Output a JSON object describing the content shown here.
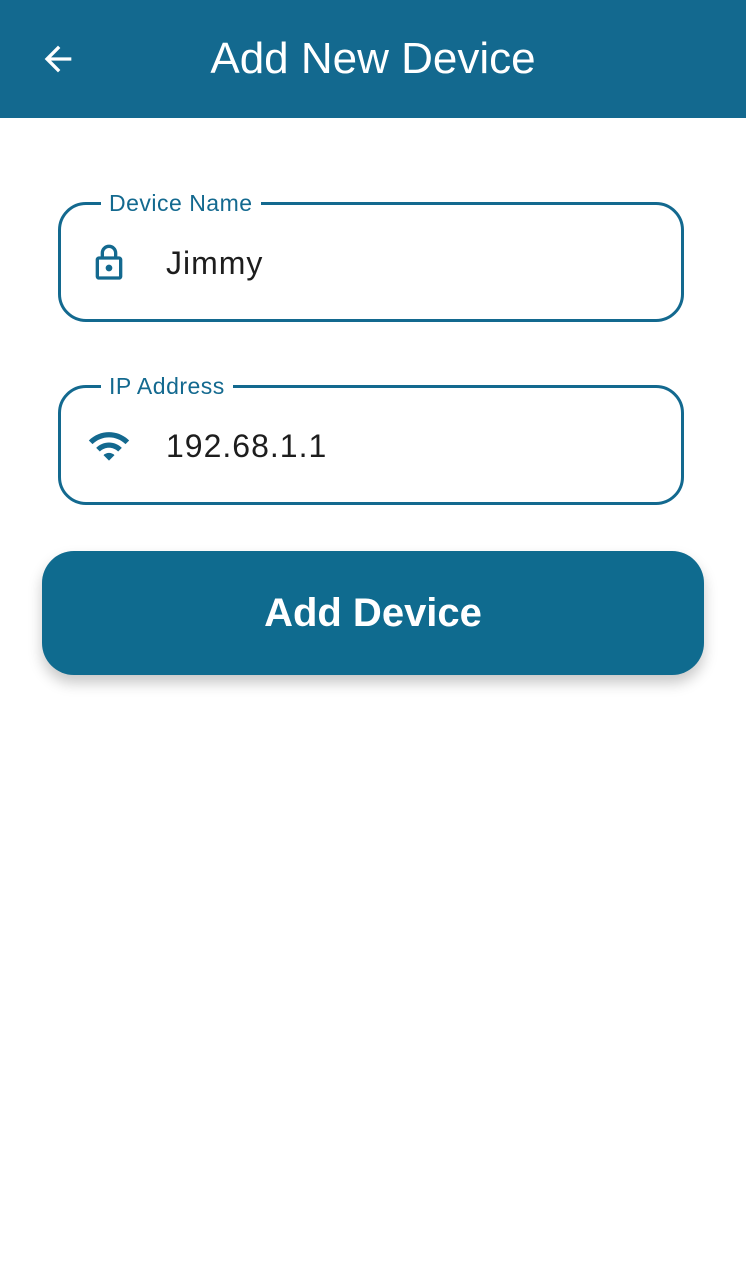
{
  "app_bar": {
    "title": "Add New Device",
    "back_icon": "arrow-left-icon",
    "background_color": "#13698f"
  },
  "form": {
    "device_name": {
      "label": "Device Name",
      "value": "Jimmy",
      "icon": "lock-icon"
    },
    "ip_address": {
      "label": "IP Address",
      "value": "192.68.1.1",
      "icon": "wifi-icon"
    }
  },
  "submit_button": {
    "label": "Add Device",
    "color": "#0f6b8f"
  }
}
